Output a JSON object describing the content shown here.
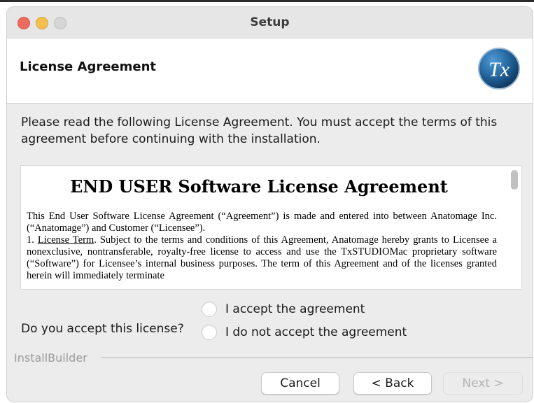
{
  "window": {
    "title": "Setup",
    "controls": [
      "close",
      "minimize",
      "maximize"
    ]
  },
  "header": {
    "title": "License Agreement",
    "logo": {
      "icon": "tx-logo",
      "text": "Tx"
    }
  },
  "intro_text": "Please read the following License Agreement. You must accept the terms of this agreement before continuing with the installation.",
  "license": {
    "heading": "END USER Software License Agreement",
    "paragraph1": "This End User Software License Agreement (“Agreement”) is made and entered into between Anatomage Inc. (“Anatomage”) and Customer (“Licensee”).",
    "item1_number": "1.",
    "item1_term": "License Term",
    "item1_text": ". Subject to the terms and conditions of this Agreement, Anatomage hereby grants to Licensee a nonexclusive, nontransferable, royalty-free license to access and use the TxSTUDIOMac proprietary software (“Software”) for Licensee’s internal business purposes. The term of this Agreement and of the licenses granted herein will immediately terminate"
  },
  "acceptance": {
    "question": "Do you accept this license?",
    "options": [
      {
        "label": "I accept the agreement",
        "selected": false
      },
      {
        "label": "I do not accept the agreement",
        "selected": false
      }
    ]
  },
  "footer": {
    "brand": "InstallBuilder"
  },
  "buttons": {
    "cancel": "Cancel",
    "back": "< Back",
    "next": "Next >",
    "next_enabled": false
  },
  "colors": {
    "close": "#ed6a5e",
    "minimize": "#f5bf4f",
    "maximize": "#d6d6d6",
    "logo_blue": "#1f5f96"
  }
}
